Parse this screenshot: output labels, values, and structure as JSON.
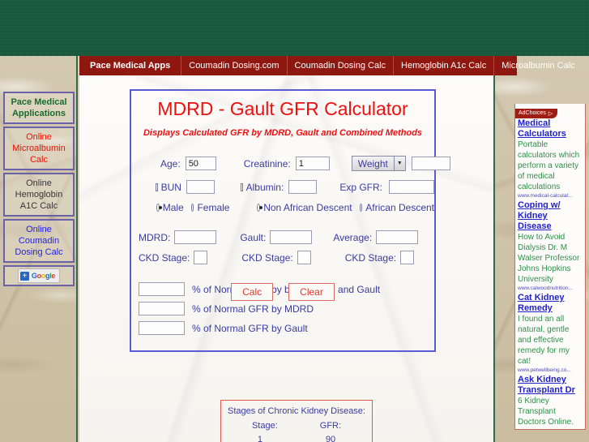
{
  "theme": {
    "banner_green": "#14573a",
    "nav_red": "#8e1710",
    "title_red": "#ee0f0f",
    "form_blue": "#3b3b9e",
    "box_border": "#5b5bd6",
    "ad_green": "#2f8f4a",
    "ad_blue": "#2222cc"
  },
  "navbar": {
    "items": [
      {
        "label": "Pace Medical Apps"
      },
      {
        "label": "Coumadin Dosing.com"
      },
      {
        "label": "Coumadin Dosing Calc"
      },
      {
        "label": "Hemoglobin A1c Calc"
      },
      {
        "label": "Microalbumin Calc"
      }
    ]
  },
  "sidebar": {
    "items": [
      {
        "label": "Pace Medical Applications",
        "style": "green"
      },
      {
        "label": "Online Microalbumin Calc",
        "style": "red"
      },
      {
        "label": "Online Hemoglobin A1C Calc",
        "style": "dark"
      },
      {
        "label": "Online Coumadin Dosing Calc",
        "style": "blue"
      }
    ],
    "google_badge": {
      "plus": "+",
      "letters": [
        "G",
        "o",
        "o",
        "g",
        "l",
        "e"
      ]
    }
  },
  "calculator": {
    "title": "MDRD - Gault GFR Calculator",
    "subtitle": "Displays Calculated GFR by MDRD, Gault and Combined Methods",
    "fields": {
      "age_label": "Age:",
      "age_value": "50",
      "creatinine_label": "Creatinine:",
      "creatinine_value": "1",
      "weight_select": "Weight",
      "weight_value": "",
      "bun_label": "BUN",
      "bun_value": "",
      "albumin_label": "Albumin:",
      "albumin_value": "",
      "exp_gfr_label": "Exp GFR:",
      "exp_gfr_value": ""
    },
    "sex": {
      "male_label": "Male",
      "female_label": "Female",
      "selected": "Male"
    },
    "descent": {
      "non_african_label": "Non African Descent",
      "african_label": "African Descent",
      "selected": "Non African Descent"
    },
    "results": {
      "mdrd_label": "MDRD:",
      "mdrd_value": "",
      "gault_label": "Gault:",
      "gault_value": "",
      "average_label": "Average:",
      "average_value": "",
      "ckd_stage_label": "CKD Stage:",
      "ckd_stage_mdrd": "",
      "ckd_stage_gault": "",
      "ckd_stage_average": ""
    },
    "percent_rows": [
      {
        "value": "",
        "label": "% of Normal GFR by both MDRD and Gault"
      },
      {
        "value": "",
        "label": "% of Normal GFR by MDRD"
      },
      {
        "value": "",
        "label": "% of Normal GFR by Gault"
      }
    ],
    "buttons": {
      "calc": "Calc",
      "clear": "Clear"
    }
  },
  "ckd_table": {
    "heading": "Stages of Chronic Kidney Disease:",
    "col_stage": "Stage:",
    "col_gfr": "GFR:",
    "rows": [
      {
        "stage": "1",
        "gfr": "90"
      }
    ]
  },
  "ads": {
    "adchoices_label": "AdChoices",
    "adchoices_icon": "▷",
    "items": [
      {
        "title": "Medical Calculators",
        "desc": "Portable calculators which perform a variety of medical calculations",
        "url": "www.medical-calculat..."
      },
      {
        "title": "Coping w/ Kidney Disease",
        "desc": "How to Avoid Dialysis Dr. M Walser Professor Johns Hopkins University",
        "url": "www.calwoodnutrition..."
      },
      {
        "title": "Cat Kidney Remedy",
        "desc": "I found an all natural, gentle and effective remedy for my cat!",
        "url": "www.petwellbeing.co..."
      },
      {
        "title": "Ask Kidney Transplant Dr",
        "desc": "6 Kidney Transplant Doctors Online.",
        "url": ""
      }
    ]
  }
}
